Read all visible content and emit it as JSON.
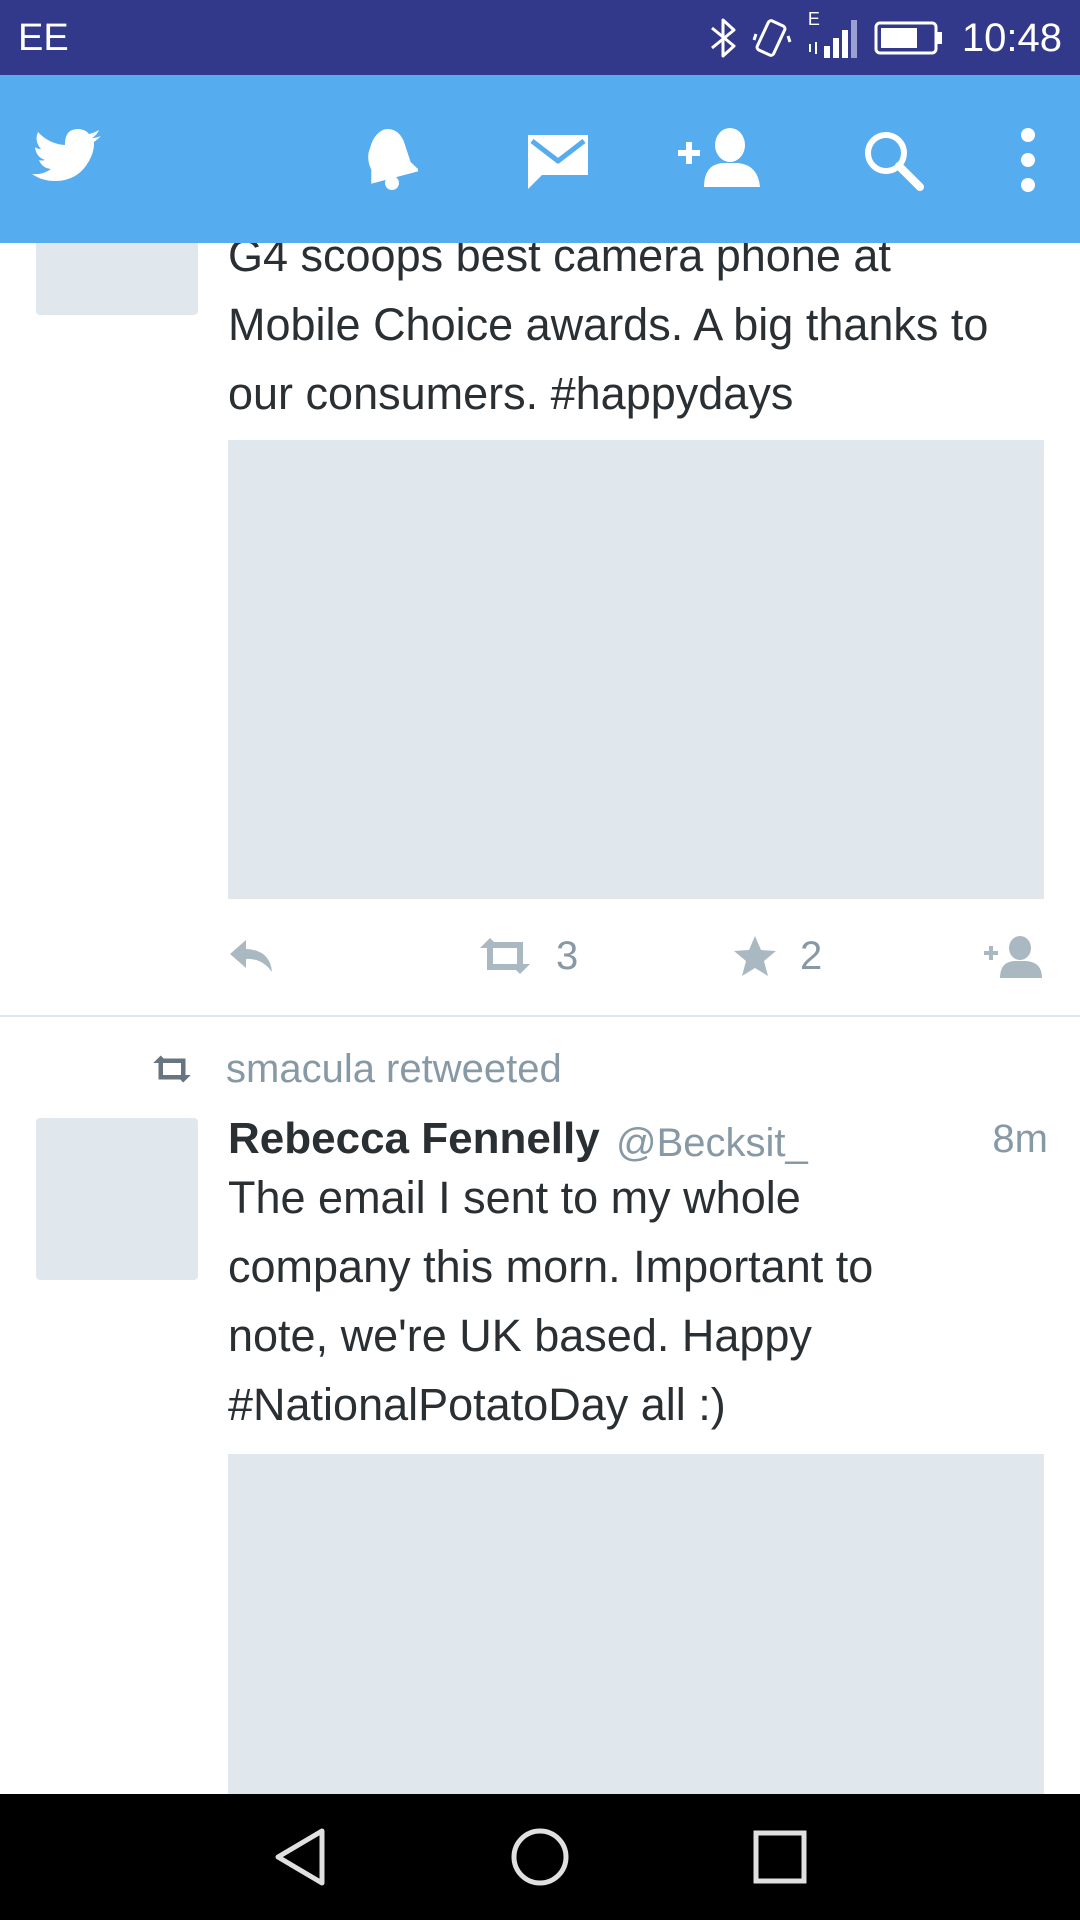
{
  "status_bar": {
    "carrier": "EE",
    "network_type": "E",
    "time": "10:48",
    "icons": [
      "bluetooth-icon",
      "vibrate-icon",
      "signal-icon",
      "battery-icon"
    ]
  },
  "app_bar": {
    "icons": [
      "twitter-bird-icon",
      "notifications-bell-icon",
      "messages-envelope-icon",
      "add-user-icon",
      "search-icon",
      "overflow-menu-icon"
    ],
    "color": "#55acee"
  },
  "feed": {
    "tweets": [
      {
        "text": "G4 scoops best camera phone at\nMobile Choice awards. A big thanks to\nour consumers. #happydays",
        "retweet_count": "3",
        "favorite_count": "2"
      },
      {
        "retweeted_by": "smacula retweeted",
        "name": "Rebecca Fennelly",
        "handle": "@Becksit_",
        "time": "8m",
        "text": "The email I sent to my whole\ncompany this morn. Important to\nnote, we're UK based. Happy\n#NationalPotatoDay all :)"
      }
    ]
  },
  "nav_bar": {
    "icons": [
      "back-icon",
      "home-icon",
      "recents-icon"
    ]
  }
}
